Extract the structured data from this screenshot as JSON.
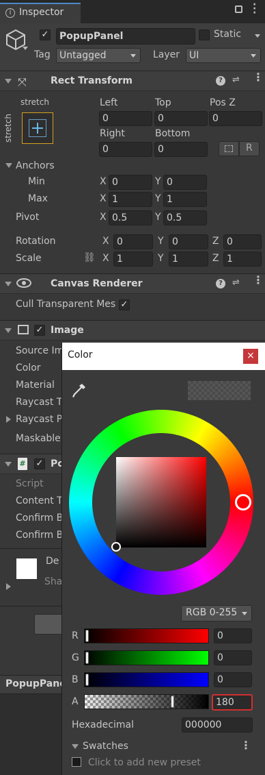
{
  "tab": {
    "title": "Inspector"
  },
  "object": {
    "name": "PopupPanel",
    "static_label": "Static",
    "tag_label": "Tag",
    "tag_value": "Untagged",
    "layer_label": "Layer",
    "layer_value": "UI"
  },
  "rect_transform": {
    "title": "Rect Transform",
    "anchor_top": "stretch",
    "anchor_side": "stretch",
    "left_label": "Left",
    "left": "0",
    "top_label": "Top",
    "top": "0",
    "posz_label": "Pos Z",
    "posz": "0",
    "right_label": "Right",
    "right": "0",
    "bottom_label": "Bottom",
    "bottom": "0",
    "r_button": "R",
    "anchors_label": "Anchors",
    "min_label": "Min",
    "min_x": "0",
    "min_y": "0",
    "max_label": "Max",
    "max_x": "1",
    "max_y": "1",
    "pivot_label": "Pivot",
    "pivot_x": "0.5",
    "pivot_y": "0.5",
    "rotation_label": "Rotation",
    "rot_x": "0",
    "rot_y": "0",
    "rot_z": "0",
    "scale_label": "Scale",
    "scale_x": "1",
    "scale_y": "1",
    "scale_z": "1",
    "x": "X",
    "y": "Y",
    "z": "Z"
  },
  "canvas_renderer": {
    "title": "Canvas Renderer",
    "cull_label": "Cull Transparent Mes"
  },
  "image": {
    "title": "Image",
    "source_label": "Source Im",
    "color_label": "Color",
    "material_label": "Material",
    "raycast_t_label": "Raycast T",
    "raycast_p_label": "Raycast P",
    "maskable_label": "Maskable"
  },
  "popup_comp": {
    "title": "Po",
    "script_label": "Script",
    "content_label": "Content T",
    "confirm1_label": "Confirm B",
    "confirm2_label": "Confirm B"
  },
  "preview": {
    "de": "De",
    "sha": "Sha"
  },
  "bottom_bar": {
    "label": "PopupPane"
  },
  "color_picker": {
    "title": "Color",
    "close": "×",
    "mode": "RGB 0-255",
    "r_label": "R",
    "r_value": "0",
    "g_label": "G",
    "g_value": "0",
    "b_label": "B",
    "b_value": "0",
    "a_label": "A",
    "a_value": "180",
    "hex_label": "Hexadecimal",
    "hex_value": "000000",
    "swatches_label": "Swatches",
    "preset_hint": "Click to add new preset"
  },
  "colors": {
    "accent_red": "#d32f2f",
    "panel": "#383838",
    "header": "#3e3e3e"
  }
}
